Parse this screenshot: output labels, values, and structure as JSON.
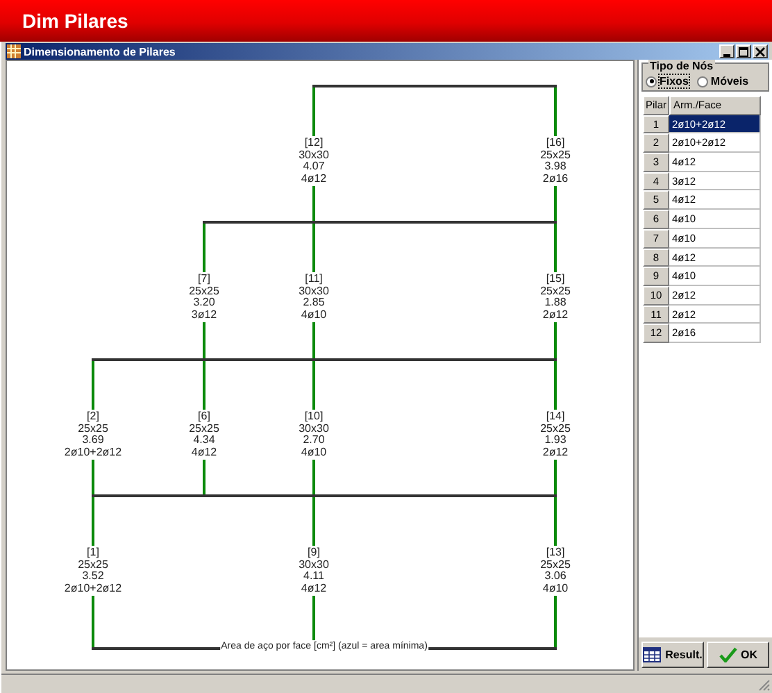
{
  "app_title": "Dim Pilares",
  "window": {
    "title": "Dimensionamento de Pilares"
  },
  "floors": [
    {
      "slots": [
        {
          "kind": "none"
        },
        {
          "kind": "none"
        },
        {
          "kind": "pillar",
          "id": "[12]",
          "section": "30x30",
          "area": "4.07",
          "rebar": "4ø12"
        },
        {
          "kind": "pillar",
          "id": "[16]",
          "section": "25x25",
          "area": "3.98",
          "rebar": "2ø16"
        }
      ]
    },
    {
      "slots": [
        {
          "kind": "none"
        },
        {
          "kind": "pillar",
          "id": "[7]",
          "section": "25x25",
          "area": "3.20",
          "rebar": "3ø12"
        },
        {
          "kind": "pillar",
          "id": "[11]",
          "section": "30x30",
          "area": "2.85",
          "rebar": "4ø10"
        },
        {
          "kind": "pillar",
          "id": "[15]",
          "section": "25x25",
          "area": "1.88",
          "rebar": "2ø12"
        }
      ]
    },
    {
      "slots": [
        {
          "kind": "pillar",
          "id": "[2]",
          "section": "25x25",
          "area": "3.69",
          "rebar": "2ø10+2ø12"
        },
        {
          "kind": "pillar",
          "id": "[6]",
          "section": "25x25",
          "area": "4.34",
          "rebar": "4ø12"
        },
        {
          "kind": "pillar",
          "id": "[10]",
          "section": "30x30",
          "area": "2.70",
          "rebar": "4ø10"
        },
        {
          "kind": "pillar",
          "id": "[14]",
          "section": "25x25",
          "area": "1.93",
          "rebar": "2ø12"
        }
      ]
    },
    {
      "slots": [
        {
          "kind": "pillar",
          "id": "[1]",
          "section": "25x25",
          "area": "3.52",
          "rebar": "2ø10+2ø12"
        },
        {
          "kind": "none"
        },
        {
          "kind": "pillar",
          "id": "[9]",
          "section": "30x30",
          "area": "4.11",
          "rebar": "4ø12"
        },
        {
          "kind": "pillar",
          "id": "[13]",
          "section": "25x25",
          "area": "3.06",
          "rebar": "4ø10"
        }
      ]
    }
  ],
  "caption": "Area de aço por face [cm²] (azul = area mínima)",
  "node_type": {
    "title": "Tipo de Nós",
    "options": [
      {
        "label": "Fixos",
        "selected": true
      },
      {
        "label": "Móveis",
        "selected": false
      }
    ]
  },
  "table": {
    "columns": [
      "Pilar",
      "Arm./Face"
    ],
    "rows": [
      {
        "pilar": "1",
        "arm": "2ø10+2ø12",
        "selected": true
      },
      {
        "pilar": "2",
        "arm": "2ø10+2ø12",
        "selected": false
      },
      {
        "pilar": "3",
        "arm": "4ø12",
        "selected": false
      },
      {
        "pilar": "4",
        "arm": "3ø12",
        "selected": false
      },
      {
        "pilar": "5",
        "arm": "4ø12",
        "selected": false
      },
      {
        "pilar": "6",
        "arm": "4ø10",
        "selected": false
      },
      {
        "pilar": "7",
        "arm": "4ø10",
        "selected": false
      },
      {
        "pilar": "8",
        "arm": "4ø12",
        "selected": false
      },
      {
        "pilar": "9",
        "arm": "4ø10",
        "selected": false
      },
      {
        "pilar": "10",
        "arm": "2ø12",
        "selected": false
      },
      {
        "pilar": "11",
        "arm": "2ø12",
        "selected": false
      },
      {
        "pilar": "12",
        "arm": "2ø16",
        "selected": false
      }
    ]
  },
  "buttons": [
    "Result.",
    "OK"
  ]
}
